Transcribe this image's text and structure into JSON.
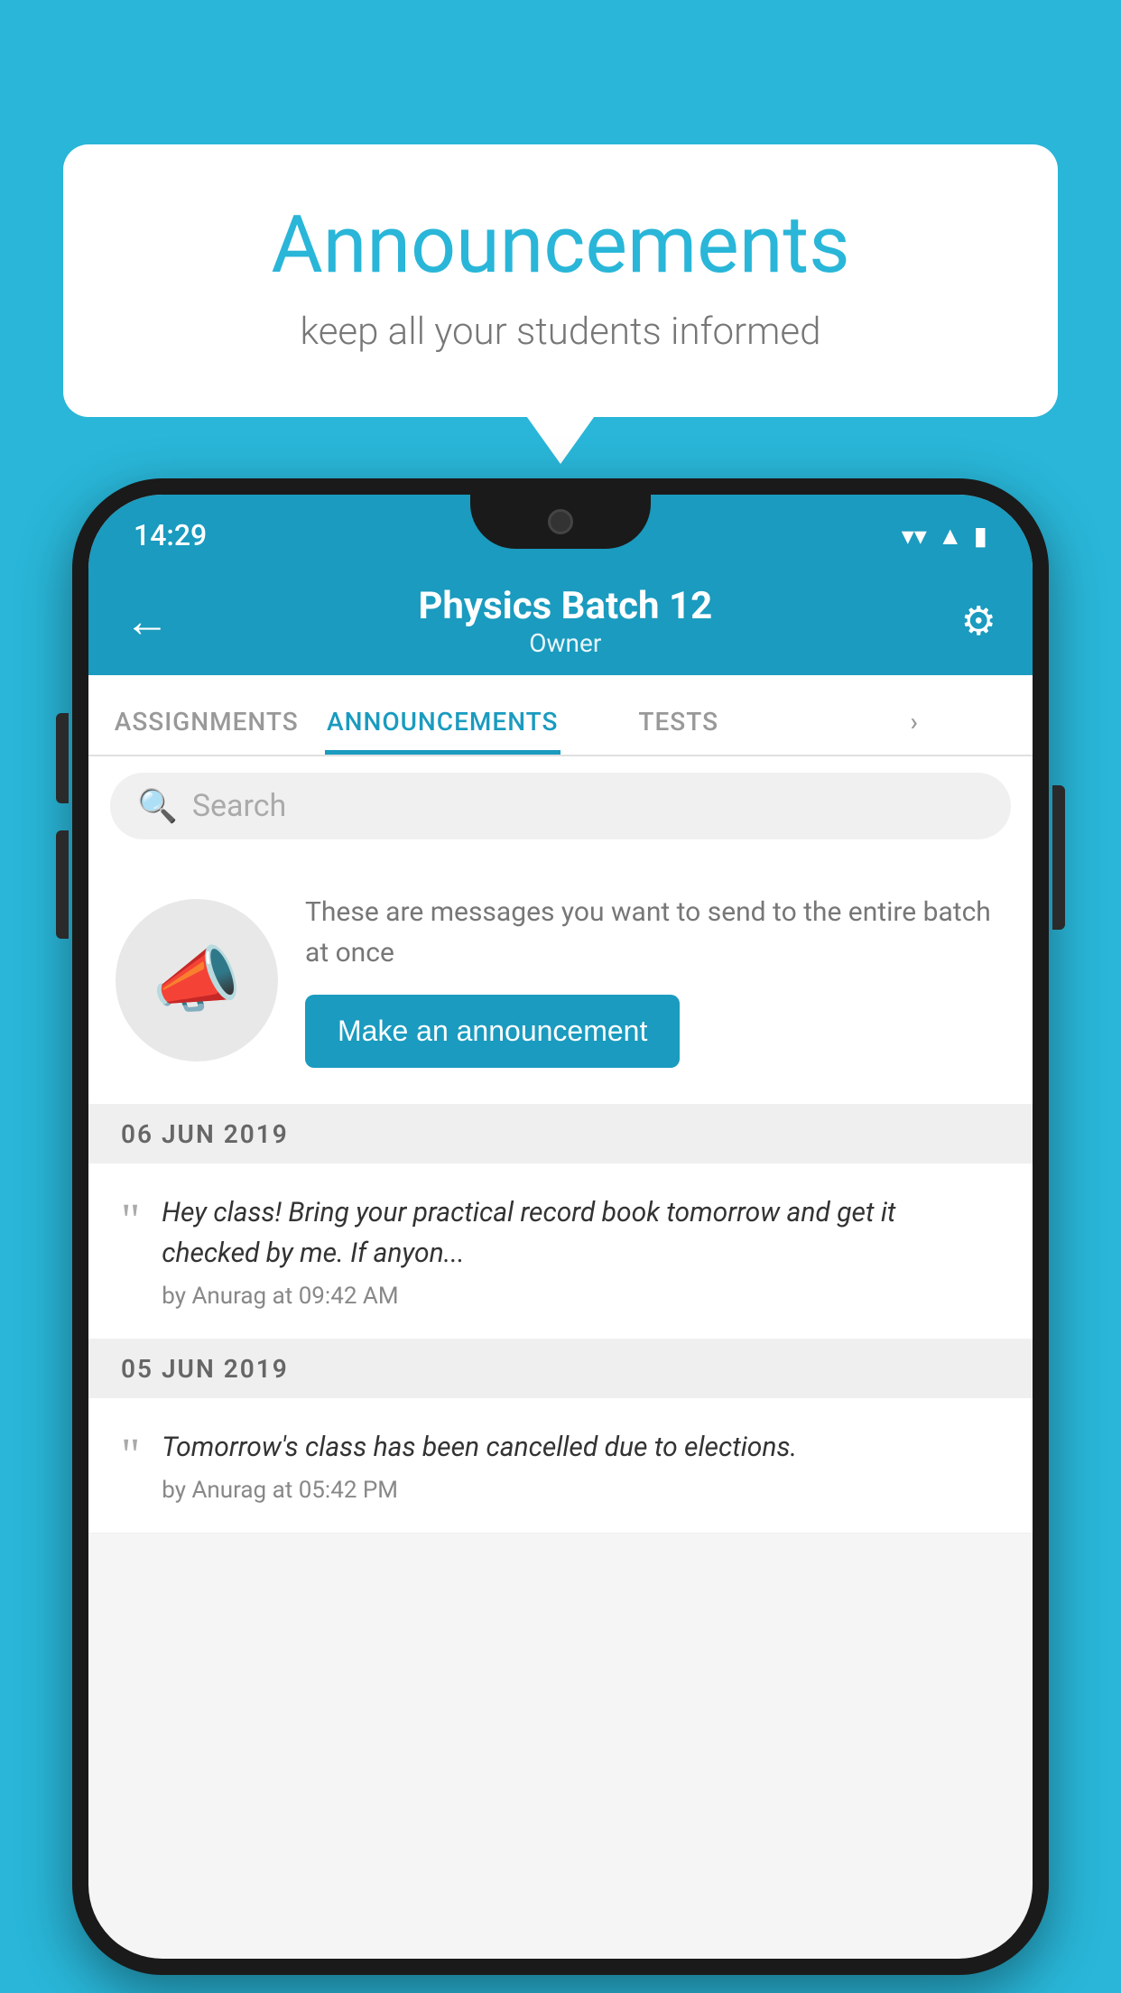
{
  "bubble": {
    "title": "Announcements",
    "subtitle": "keep all your students informed"
  },
  "statusBar": {
    "time": "14:29",
    "wifiIcon": "▾",
    "signalIcon": "▲",
    "batteryIcon": "▮"
  },
  "header": {
    "title": "Physics Batch 12",
    "subtitle": "Owner",
    "backLabel": "←",
    "settingsLabel": "⚙"
  },
  "tabs": [
    {
      "label": "ASSIGNMENTS",
      "active": false
    },
    {
      "label": "ANNOUNCEMENTS",
      "active": true
    },
    {
      "label": "TESTS",
      "active": false
    },
    {
      "label": "•••",
      "active": false
    }
  ],
  "search": {
    "placeholder": "Search"
  },
  "promo": {
    "text": "These are messages you want to send to the entire batch at once",
    "buttonLabel": "Make an announcement"
  },
  "announcements": [
    {
      "date": "06  JUN  2019",
      "text": "Hey class! Bring your practical record book tomorrow and get it checked by me. If anyon...",
      "meta": "by Anurag at 09:42 AM"
    },
    {
      "date": "05  JUN  2019",
      "text": "Tomorrow's class has been cancelled due to elections.",
      "meta": "by Anurag at 05:42 PM"
    }
  ],
  "colors": {
    "accent": "#1a9bbf",
    "background": "#29b6d8"
  }
}
